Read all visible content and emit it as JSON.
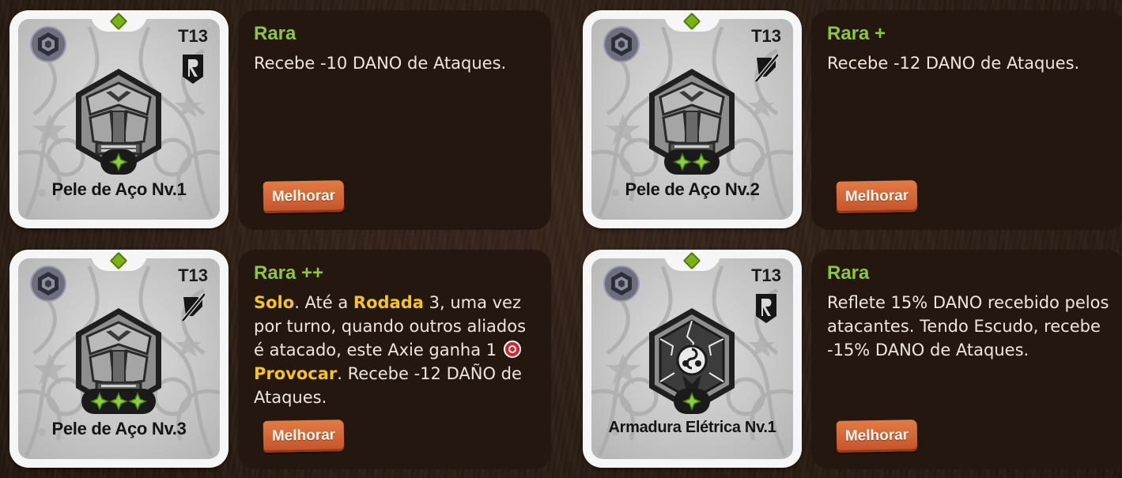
{
  "cards": [
    {
      "tier": "T13",
      "name": "Pele de Aço Nv.1",
      "rarity": "Rara",
      "type_icon": "r-shield-icon",
      "emblem": "steel-skin",
      "pips": 1,
      "description": [
        {
          "text": "Recebe -10 DANO de Ataques."
        }
      ],
      "button": "Melhorar"
    },
    {
      "tier": "T13",
      "name": "Pele de Aço Nv.2",
      "rarity": "Rara +",
      "type_icon": "slashed-icon",
      "emblem": "steel-skin",
      "pips": 2,
      "description": [
        {
          "text": "Recebe -12 DANO de Ataques."
        }
      ],
      "button": "Melhorar"
    },
    {
      "tier": "T13",
      "name": "Pele de Aço Nv.3",
      "rarity": "Rara ++",
      "type_icon": "slashed-icon",
      "emblem": "steel-skin",
      "pips": 3,
      "description": [
        {
          "text": "Solo",
          "kw": true
        },
        {
          "text": ". Até a "
        },
        {
          "text": "Rodada",
          "kw": true
        },
        {
          "text": " 3, uma vez por turno, quando outros aliados é atacado, este Axie ganha 1 "
        },
        {
          "icon": "taunt-icon"
        },
        {
          "text": " "
        },
        {
          "text": "Provocar",
          "kw": true
        },
        {
          "text": ". Recebe -12 DAÑO de Ataques."
        }
      ],
      "button": "Melhorar"
    },
    {
      "tier": "T13",
      "name": "Armadura Elétrica Nv.1",
      "rarity": "Rara",
      "type_icon": "r-shield-icon",
      "emblem": "electric-armor",
      "pips": 1,
      "description": [
        {
          "text": "Reflete 15% DANO recebido pelos atacantes. Tendo Escudo, recebe -15% DANO de Ataques."
        }
      ],
      "button": "Melhorar"
    }
  ],
  "colors": {
    "rarity": "#8ec63f",
    "keyword": "#f5c423",
    "button": "#d8673a",
    "panel": "#24170f",
    "gem": "#7ab317"
  }
}
